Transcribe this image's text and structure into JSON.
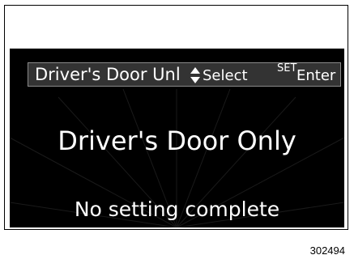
{
  "display": {
    "header": {
      "title": "Driver's Door Unl",
      "select_label": "Select",
      "set_label": "SET",
      "enter_label": "Enter",
      "updown_icon": "updown-arrows-icon"
    },
    "main_option": "Driver's Door Only",
    "status_message": "No setting complete"
  },
  "figure": {
    "number": "302494"
  },
  "colors": {
    "screen_background": "#000000",
    "header_background": "#333333",
    "text": "#ffffff"
  }
}
